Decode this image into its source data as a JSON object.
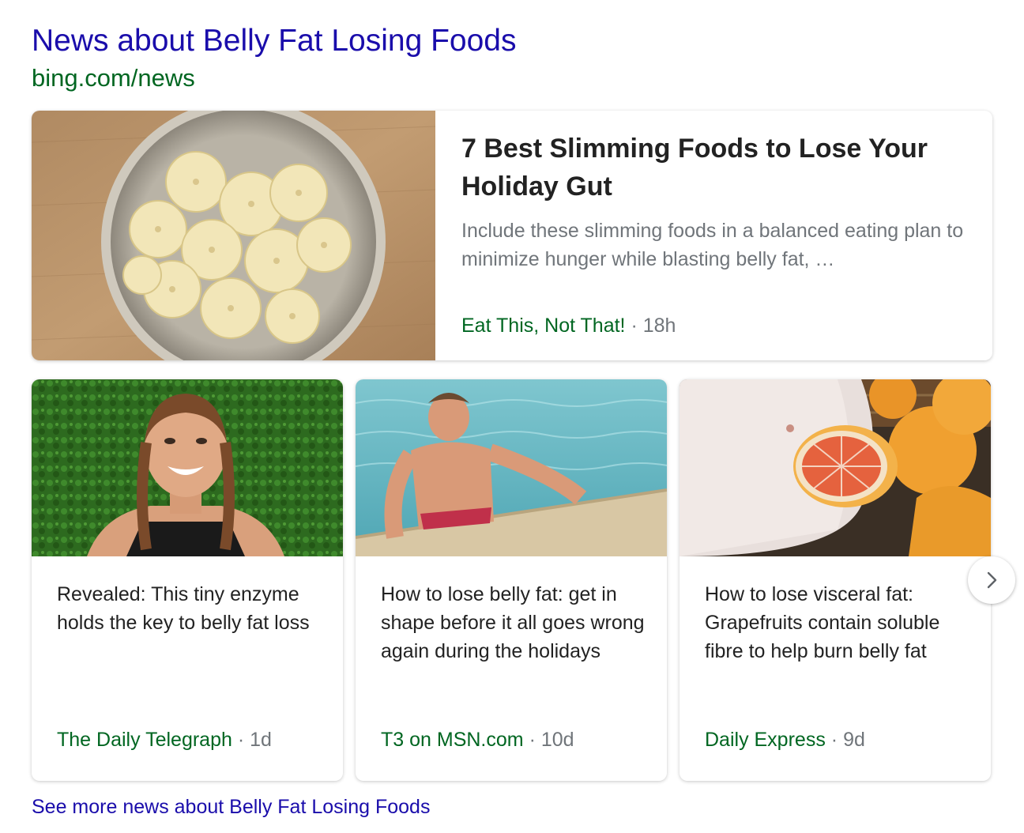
{
  "header": {
    "title": "News about Belly Fat Losing Foods",
    "source_url": "bing.com/news"
  },
  "hero": {
    "headline": "7 Best Slimming Foods to Lose Your Holiday Gut",
    "snippet": "Include these slimming foods in a balanced eating plan to minimize hunger while blasting belly fat, …",
    "source": "Eat This, Not That!",
    "separator": "·",
    "age": "18h",
    "image": "bowl-of-sliced-bananas"
  },
  "cards": [
    {
      "headline": "Revealed: This tiny enzyme holds the key to belly fat loss",
      "source": "The Daily Telegraph",
      "separator": "·",
      "age": "1d",
      "image": "smiling-woman-with-braids"
    },
    {
      "headline": "How to lose belly fat: get in shape before it all goes wrong again during the holidays",
      "source": "T3 on MSN.com",
      "separator": "·",
      "age": "10d",
      "image": "man-climbing-out-of-pool"
    },
    {
      "headline": "How to lose visceral fat: Grapefruits contain soluble fibre to help burn belly fat",
      "source": "Daily Express",
      "separator": "·",
      "age": "9d",
      "image": "belly-with-grapefruits"
    }
  ],
  "carousel": {
    "next_icon": "chevron-right-icon"
  },
  "footer": {
    "see_more": "See more news about Belly Fat Losing Foods"
  },
  "colors": {
    "link": "#1a0dab",
    "source_green": "#006621",
    "headline": "#222222",
    "muted": "#70757a"
  }
}
